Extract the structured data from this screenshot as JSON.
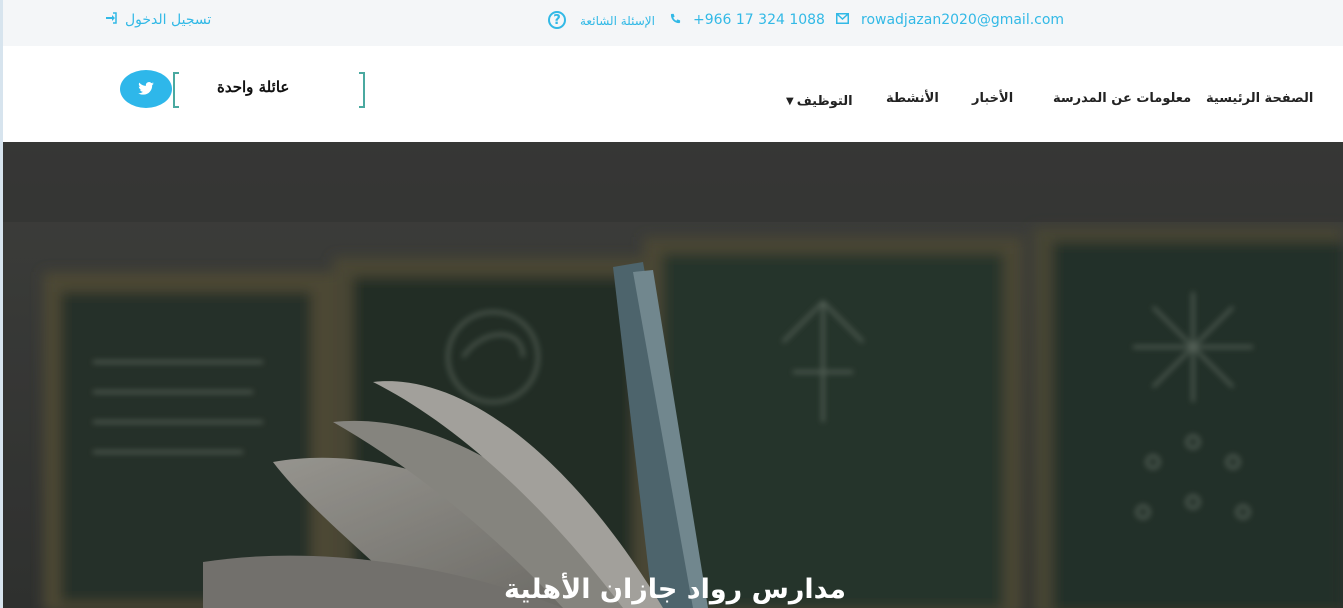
{
  "topbar": {
    "login_label": "تسجيل الدخول",
    "login_icon": "sign-in-icon",
    "faq_label": "الإسئلة الشائعة",
    "faq_icon": "question-circle-icon",
    "phone": "+966 17 324 1088",
    "phone_icon": "phone-icon",
    "email": "rowadjazan2020@gmail.com",
    "email_icon": "envelope-icon"
  },
  "header": {
    "logo_motto": "عائلة واحدة",
    "social": {
      "twitter_icon": "twitter-icon"
    },
    "nav": {
      "home": "الصفحة الرئيسية",
      "about": "معلومات عن المدرسة",
      "news": "الأخبار",
      "activities": "الأنشطة",
      "jobs": "التوظيف"
    }
  },
  "hero": {
    "title": "مدارس رواد جازان الأهلية"
  },
  "colors": {
    "accent": "#32b9e6",
    "twitter": "#2eb7ea",
    "logo_bracket": "#4aa9a0",
    "topbar_bg": "#f4f6f8"
  }
}
